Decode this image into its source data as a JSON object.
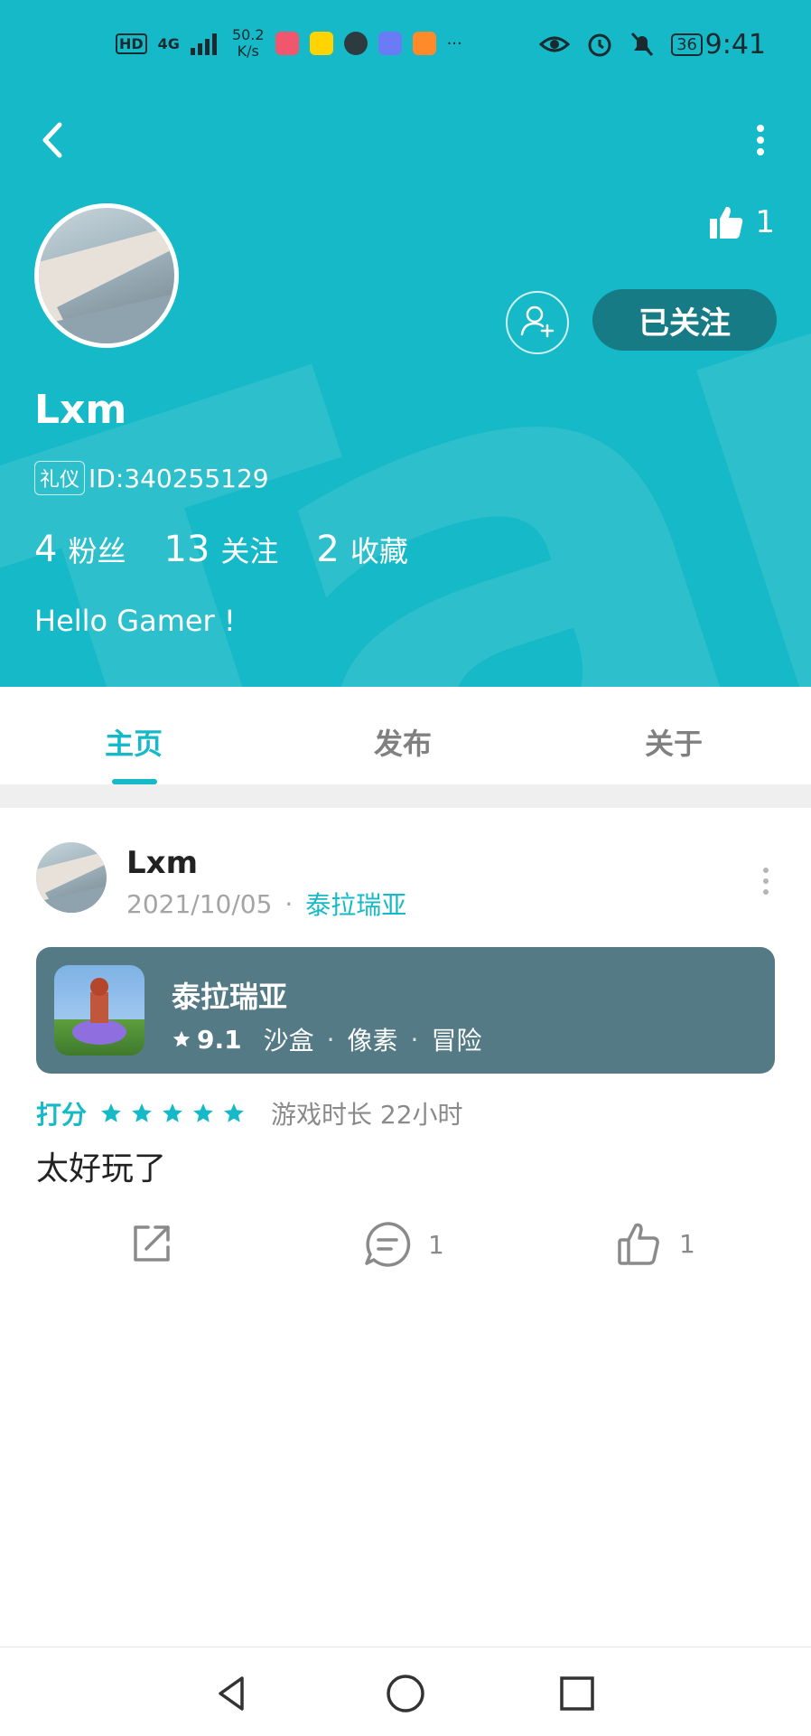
{
  "status_bar": {
    "left_labels": [
      "HD",
      "4G"
    ],
    "speed_value": "50.2",
    "speed_unit": "K/s",
    "more": "···",
    "battery": "36",
    "time": "9:41"
  },
  "profile": {
    "name": "Lxm",
    "badge": "礼仪",
    "id_text": "ID:340255129",
    "likes": "1",
    "follow_label": "已关注",
    "stats": [
      {
        "num": "4",
        "label": "粉丝"
      },
      {
        "num": "13",
        "label": "关注"
      },
      {
        "num": "2",
        "label": "收藏"
      }
    ],
    "bio": "Hello Gamer !"
  },
  "tabs": [
    {
      "label": "主页",
      "active": true
    },
    {
      "label": "发布",
      "active": false
    },
    {
      "label": "关于",
      "active": false
    }
  ],
  "post": {
    "author": "Lxm",
    "date": "2021/10/05",
    "separator": "·",
    "game_tag": "泰拉瑞亚",
    "game": {
      "name": "泰拉瑞亚",
      "score": "9.1",
      "tags": [
        "沙盒",
        "像素",
        "冒险"
      ],
      "tag_separator": "·"
    },
    "rating_label": "打分",
    "stars": 5,
    "playtime": "游戏时长 22小时",
    "text": "太好玩了",
    "comment_count": "1",
    "like_count": "1"
  },
  "colors": {
    "accent": "#16b9c7",
    "follow_button": "#167b84",
    "game_card": "#547a86"
  },
  "icons": [
    "back-icon",
    "more-vertical-icon",
    "thumbs-up-icon",
    "add-friend-icon",
    "star-icon",
    "share-icon",
    "comment-icon",
    "nav-back-icon",
    "nav-home-icon",
    "nav-recents-icon"
  ]
}
